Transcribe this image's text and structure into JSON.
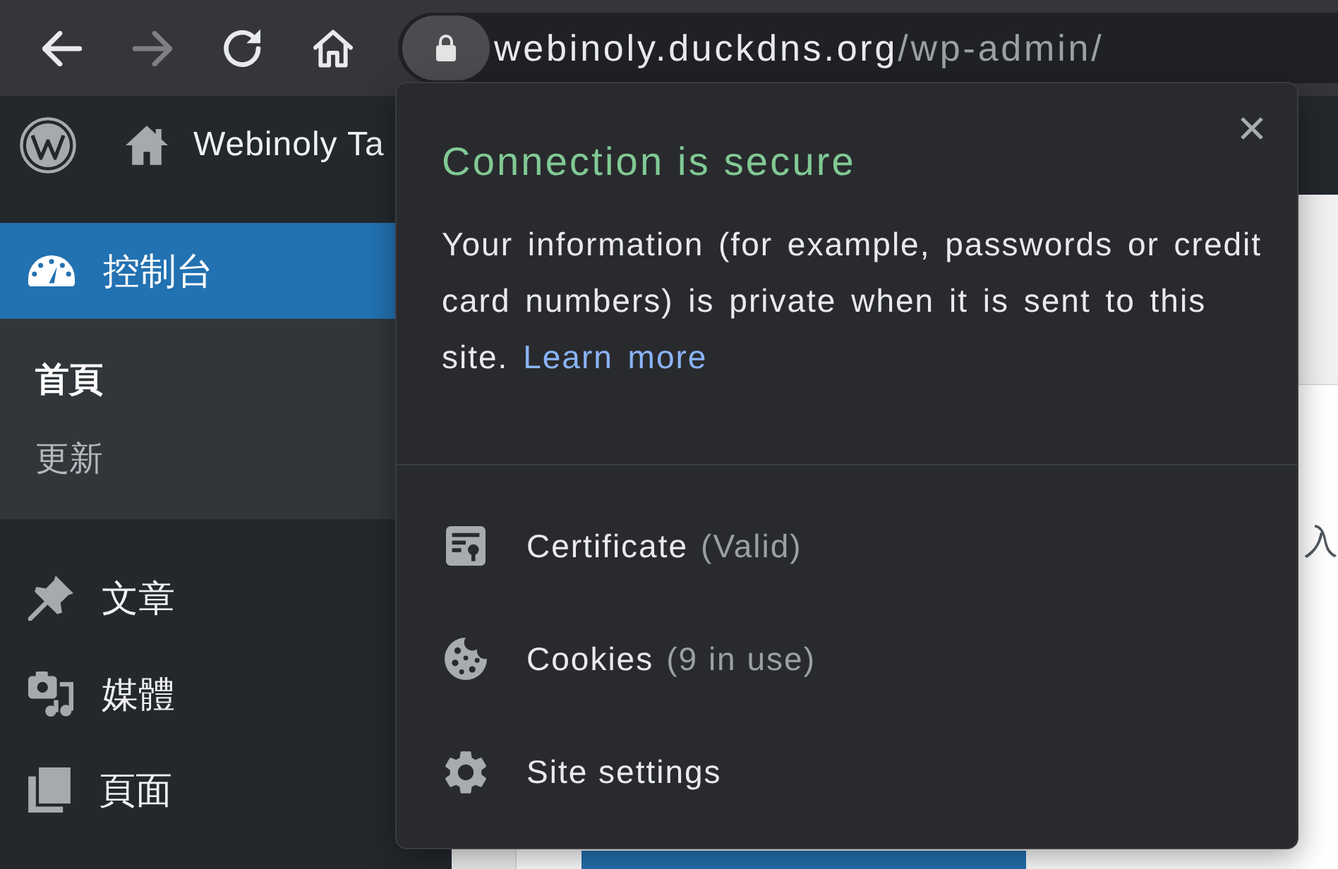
{
  "browser_toolbar": {
    "nav_buttons": [
      {
        "kind": "back",
        "disabled": false
      },
      {
        "kind": "forward",
        "disabled": true
      },
      {
        "kind": "reload",
        "disabled": false
      },
      {
        "kind": "home",
        "disabled": false
      }
    ],
    "address": {
      "host": "webinoly.duckdns.org",
      "path": "/wp-admin/"
    }
  },
  "admin_bar": {
    "site_name": "Webinoly Ta"
  },
  "sidebar": {
    "items": [
      {
        "label": "控制台",
        "kind": "dashboard",
        "selected": true,
        "children": [
          {
            "label": "首頁",
            "selected": true
          },
          {
            "label": "更新",
            "selected": false
          }
        ]
      },
      {
        "label": "文章",
        "kind": "posts",
        "selected": false
      },
      {
        "label": "媒體",
        "kind": "media",
        "selected": false
      },
      {
        "label": "頁面",
        "kind": "pages",
        "selected": false
      }
    ]
  },
  "main": {
    "text_fragment": "入"
  },
  "site_info_popup": {
    "title": "Connection is secure",
    "message": "Your information (for example, passwords or credit card numbers) is private when it is sent to this site.",
    "link": "Learn more",
    "items": [
      {
        "kind": "certificate",
        "label": "Certificate",
        "detail": "(Valid)"
      },
      {
        "kind": "cookies",
        "label": "Cookies",
        "detail": "(9 in use)"
      },
      {
        "kind": "settings",
        "label": "Site settings"
      }
    ]
  }
}
